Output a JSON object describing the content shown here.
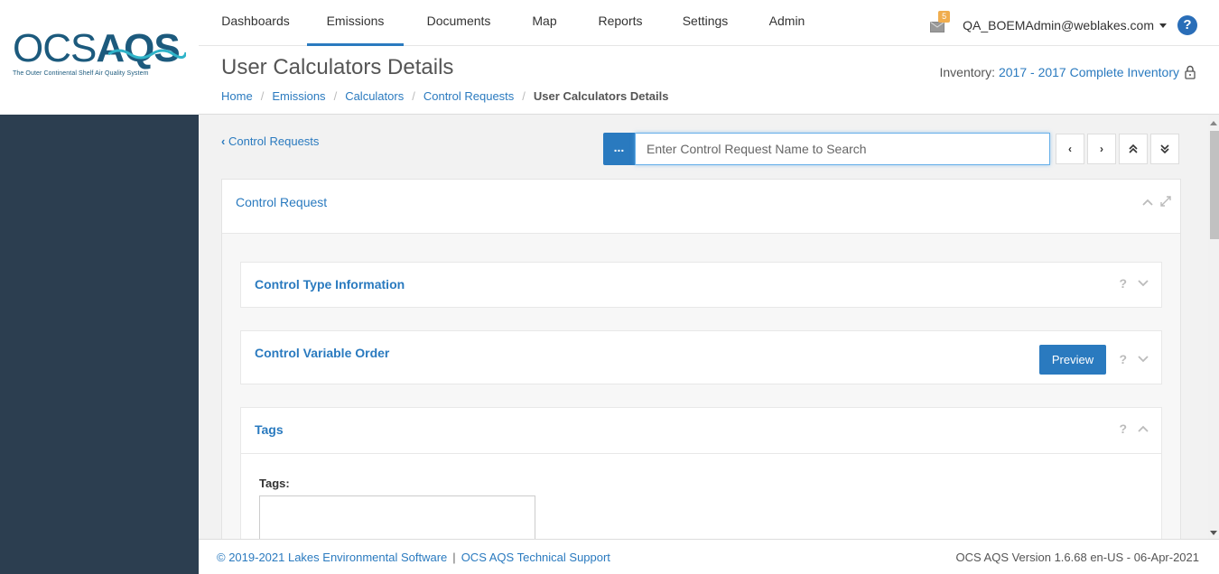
{
  "logo": {
    "text_ocs": "OCS",
    "text_aqs": "AQS",
    "tagline": "The Outer Continental Shelf Air Quality System"
  },
  "nav": {
    "items": [
      {
        "label": "Dashboards"
      },
      {
        "label": "Emissions"
      },
      {
        "label": "Documents"
      },
      {
        "label": "Map"
      },
      {
        "label": "Reports"
      },
      {
        "label": "Settings"
      },
      {
        "label": "Admin"
      }
    ],
    "active": "Emissions",
    "mail_count": "5",
    "user_email": "QA_BOEMAdmin@weblakes.com",
    "help_label": "?"
  },
  "header": {
    "title": "User Calculators Details",
    "breadcrumb": [
      "Home",
      "Emissions",
      "Calculators",
      "Control Requests"
    ],
    "breadcrumb_current": "User Calculators Details",
    "inventory_label": "Inventory:",
    "inventory_value": "2017 - 2017 Complete Inventory"
  },
  "toolbar": {
    "back_label": "Control Requests",
    "dots_label": "...",
    "search_placeholder": "Enter Control Request Name to Search"
  },
  "panel": {
    "title": "Control Request",
    "sections": [
      {
        "title": "Control Type Information"
      },
      {
        "title": "Control Variable Order",
        "button": "Preview"
      },
      {
        "title": "Tags",
        "field_label": "Tags:"
      }
    ]
  },
  "footer": {
    "copyright": "© 2019-2021 Lakes Environmental Software",
    "separator": "|",
    "support_link": "OCS AQS Technical Support",
    "version": "OCS AQS Version 1.6.68 en-US - 06-Apr-2021"
  },
  "colors": {
    "accent": "#2a7abf",
    "sidebar": "#2c3e50",
    "badge": "#f0ad4e"
  }
}
